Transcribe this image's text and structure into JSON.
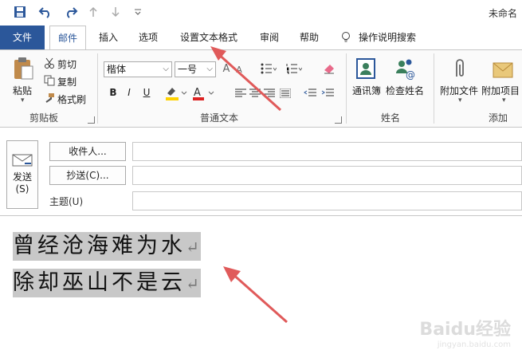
{
  "window": {
    "title": "未命名"
  },
  "quick_access": {
    "icons": [
      "save-icon",
      "undo-icon",
      "redo-icon",
      "up-arrow-icon",
      "down-arrow-icon",
      "customize-qat-icon"
    ]
  },
  "tabs": [
    {
      "label": "文件"
    },
    {
      "label": "邮件"
    },
    {
      "label": "插入"
    },
    {
      "label": "选项"
    },
    {
      "label": "设置文本格式"
    },
    {
      "label": "审阅"
    },
    {
      "label": "帮助"
    }
  ],
  "tell_me": {
    "label": "操作说明搜索"
  },
  "ribbon": {
    "clipboard": {
      "paste": "粘贴",
      "cut": "剪切",
      "copy": "复制",
      "format_painter": "格式刷",
      "group_label": "剪贴板"
    },
    "basic_text": {
      "font_name": "楷体",
      "font_size": "一号",
      "bold": "B",
      "italic": "I",
      "underline": "U",
      "group_label": "普通文本"
    },
    "names": {
      "address_book": "通讯簿",
      "check_names": "检查姓名",
      "group_label": "姓名"
    },
    "include": {
      "attach_file": "附加文件",
      "attach_item": "附加项目",
      "group_label": "添加"
    }
  },
  "compose": {
    "send_label": "发送",
    "send_key": "(S)",
    "to_button": "收件人...",
    "cc_button": "抄送(C)...",
    "subject_label": "主题(U)",
    "to_value": "",
    "cc_value": "",
    "subject_value": ""
  },
  "body": {
    "lines": [
      "曾经沧海难为水",
      "除却巫山不是云"
    ],
    "paragraph_mark": "↵",
    "highlight_color": "#c8c8c8"
  },
  "watermark": {
    "text": "Baidu经验",
    "url_text": "jingyan.baidu.com"
  },
  "colors": {
    "file_tab": "#2b579a",
    "annotation_arrow": "#e05a5a",
    "highlight_yellow": "#ffd200",
    "font_red": "#d22"
  }
}
